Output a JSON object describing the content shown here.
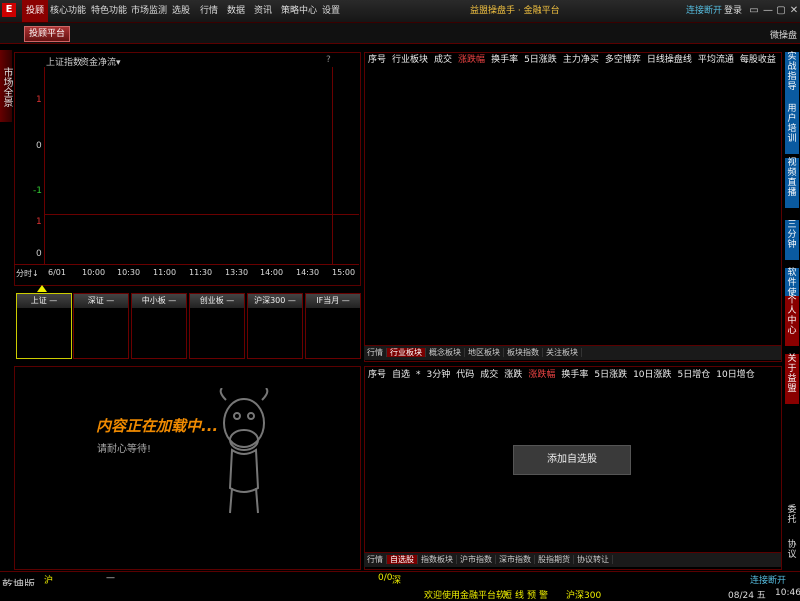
{
  "titlebar": {
    "menu": [
      "投顾",
      "核心功能",
      "特色功能",
      "市场监测",
      "选股",
      "行情",
      "数据",
      "资讯",
      "策略中心",
      "设置"
    ],
    "title": "益盟操盘手 · 金融平台",
    "connect": "连接断开",
    "login": "登录",
    "win": [
      "▭",
      "—",
      "▢",
      "✕"
    ]
  },
  "subbar": {
    "platform": "投顾平台",
    "micro": "微操盘"
  },
  "lefttab": "市场全景",
  "chart": {
    "tab1": "上证指数",
    "tab2": "资金净流▾",
    "help": "?",
    "yticks": [
      "1",
      "0",
      "-1",
      "1",
      "0"
    ],
    "period": "分时↓",
    "xticks": [
      "6/01",
      "10:00",
      "10:30",
      "11:00",
      "11:30",
      "13:30",
      "14:00",
      "14:30",
      "15:00"
    ]
  },
  "chart_data": {
    "type": "line",
    "x": [
      "6/01",
      "10:00",
      "10:30",
      "11:00",
      "11:30",
      "13:30",
      "14:00",
      "14:30",
      "15:00"
    ],
    "series": [],
    "ylim": [
      -1,
      1
    ]
  },
  "indices": [
    {
      "name": "上证",
      "val": "—"
    },
    {
      "name": "深证",
      "val": "—"
    },
    {
      "name": "中小板",
      "val": "—"
    },
    {
      "name": "创业板",
      "val": "—"
    },
    {
      "name": "沪深300",
      "val": "—"
    },
    {
      "name": "IF当月",
      "val": "—"
    }
  ],
  "loading": {
    "main": "内容正在加载中...",
    "sub": "请耐心等待!"
  },
  "sector": {
    "headers": [
      "序号",
      "行业板块",
      "成交",
      "涨跌幅",
      "换手率",
      "5日涨跌",
      "主力净买",
      "多空博弈",
      "日线操盘线",
      "平均流通",
      "每股收益"
    ],
    "tabs": [
      "行情",
      "行业板块",
      "概念板块",
      "地区板块",
      "板块指数",
      "关注板块"
    ]
  },
  "watch": {
    "headers": [
      "序号",
      "自选",
      "*",
      "3分钟",
      "代码",
      "成交",
      "涨跌",
      "涨跌幅",
      "换手率",
      "5日涨跌",
      "10日涨跌",
      "5日增仓",
      "10日增仓"
    ],
    "tabs": [
      "行情",
      "自选股",
      "指数板块",
      "沪市指数",
      "深市指数",
      "股指期货",
      "协议转让"
    ],
    "add": "添加自选股"
  },
  "rightnav": [
    "实战指导",
    "用户培训",
    "视频直播",
    "三分钟",
    "软件使用",
    "个人中心",
    "关于益盟",
    "委托",
    "协议"
  ],
  "bottom": {
    "version": "乾坤版",
    "sh": "沪",
    "sh_val": "0/0",
    "sz": "深",
    "dash": "—",
    "welcome": "欢迎使用金融平台软!",
    "links": [
      "短",
      "线",
      "预",
      "警"
    ],
    "hs": "沪深300",
    "conn": "连接断开",
    "date": "08/24 五",
    "time": "10:46"
  }
}
